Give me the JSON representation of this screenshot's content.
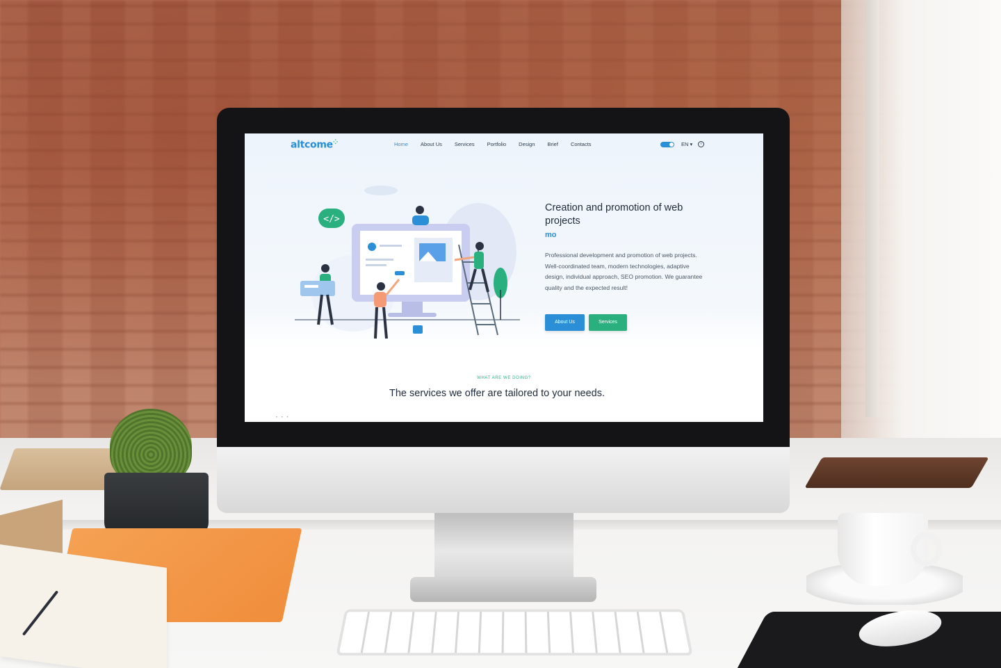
{
  "site": {
    "logo": "altcome",
    "nav": {
      "items": [
        {
          "label": "Home",
          "active": true
        },
        {
          "label": "About Us",
          "active": false
        },
        {
          "label": "Services",
          "active": false
        },
        {
          "label": "Portfolio",
          "active": false
        },
        {
          "label": "Design",
          "active": false
        },
        {
          "label": "Brief",
          "active": false
        },
        {
          "label": "Contacts",
          "active": false
        }
      ],
      "language": "EN",
      "info_glyph": "i"
    },
    "hero": {
      "title": "Creation and promotion of web projects",
      "typed_text": "mo",
      "description": "Professional development and promotion of web projects. Well-coordinated team, modern technologies, adaptive design, individual approach, SEO promotion. We guarantee quality and the expected result!",
      "about_button": "About Us",
      "services_button": "Services",
      "code_bubble": "</>"
    },
    "services_section": {
      "eyebrow": "WHAT ARE WE DOING?",
      "title": "The services we offer are tailored to your needs."
    },
    "slider_dots": "• • •"
  },
  "colors": {
    "brand_blue": "#2a8fd6",
    "brand_green": "#2ab07f",
    "heading": "#1e2a38",
    "body_text": "#4a5663",
    "screen_bg": "#edf4fb"
  },
  "icons": {
    "info": "info-icon",
    "toggle": "theme-toggle-icon",
    "code": "code-bubble-icon"
  }
}
